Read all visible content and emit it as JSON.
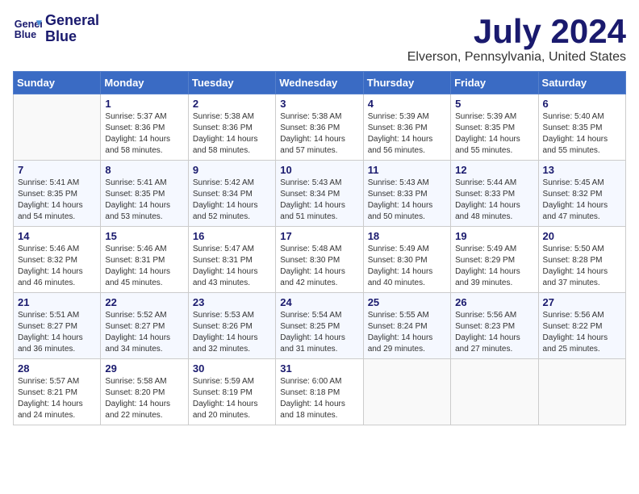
{
  "header": {
    "logo_line1": "General",
    "logo_line2": "Blue",
    "month": "July 2024",
    "location": "Elverson, Pennsylvania, United States"
  },
  "days_of_week": [
    "Sunday",
    "Monday",
    "Tuesday",
    "Wednesday",
    "Thursday",
    "Friday",
    "Saturday"
  ],
  "weeks": [
    [
      {
        "day": "",
        "sunrise": "",
        "sunset": "",
        "daylight": ""
      },
      {
        "day": "1",
        "sunrise": "Sunrise: 5:37 AM",
        "sunset": "Sunset: 8:36 PM",
        "daylight": "Daylight: 14 hours and 58 minutes."
      },
      {
        "day": "2",
        "sunrise": "Sunrise: 5:38 AM",
        "sunset": "Sunset: 8:36 PM",
        "daylight": "Daylight: 14 hours and 58 minutes."
      },
      {
        "day": "3",
        "sunrise": "Sunrise: 5:38 AM",
        "sunset": "Sunset: 8:36 PM",
        "daylight": "Daylight: 14 hours and 57 minutes."
      },
      {
        "day": "4",
        "sunrise": "Sunrise: 5:39 AM",
        "sunset": "Sunset: 8:36 PM",
        "daylight": "Daylight: 14 hours and 56 minutes."
      },
      {
        "day": "5",
        "sunrise": "Sunrise: 5:39 AM",
        "sunset": "Sunset: 8:35 PM",
        "daylight": "Daylight: 14 hours and 55 minutes."
      },
      {
        "day": "6",
        "sunrise": "Sunrise: 5:40 AM",
        "sunset": "Sunset: 8:35 PM",
        "daylight": "Daylight: 14 hours and 55 minutes."
      }
    ],
    [
      {
        "day": "7",
        "sunrise": "Sunrise: 5:41 AM",
        "sunset": "Sunset: 8:35 PM",
        "daylight": "Daylight: 14 hours and 54 minutes."
      },
      {
        "day": "8",
        "sunrise": "Sunrise: 5:41 AM",
        "sunset": "Sunset: 8:35 PM",
        "daylight": "Daylight: 14 hours and 53 minutes."
      },
      {
        "day": "9",
        "sunrise": "Sunrise: 5:42 AM",
        "sunset": "Sunset: 8:34 PM",
        "daylight": "Daylight: 14 hours and 52 minutes."
      },
      {
        "day": "10",
        "sunrise": "Sunrise: 5:43 AM",
        "sunset": "Sunset: 8:34 PM",
        "daylight": "Daylight: 14 hours and 51 minutes."
      },
      {
        "day": "11",
        "sunrise": "Sunrise: 5:43 AM",
        "sunset": "Sunset: 8:33 PM",
        "daylight": "Daylight: 14 hours and 50 minutes."
      },
      {
        "day": "12",
        "sunrise": "Sunrise: 5:44 AM",
        "sunset": "Sunset: 8:33 PM",
        "daylight": "Daylight: 14 hours and 48 minutes."
      },
      {
        "day": "13",
        "sunrise": "Sunrise: 5:45 AM",
        "sunset": "Sunset: 8:32 PM",
        "daylight": "Daylight: 14 hours and 47 minutes."
      }
    ],
    [
      {
        "day": "14",
        "sunrise": "Sunrise: 5:46 AM",
        "sunset": "Sunset: 8:32 PM",
        "daylight": "Daylight: 14 hours and 46 minutes."
      },
      {
        "day": "15",
        "sunrise": "Sunrise: 5:46 AM",
        "sunset": "Sunset: 8:31 PM",
        "daylight": "Daylight: 14 hours and 45 minutes."
      },
      {
        "day": "16",
        "sunrise": "Sunrise: 5:47 AM",
        "sunset": "Sunset: 8:31 PM",
        "daylight": "Daylight: 14 hours and 43 minutes."
      },
      {
        "day": "17",
        "sunrise": "Sunrise: 5:48 AM",
        "sunset": "Sunset: 8:30 PM",
        "daylight": "Daylight: 14 hours and 42 minutes."
      },
      {
        "day": "18",
        "sunrise": "Sunrise: 5:49 AM",
        "sunset": "Sunset: 8:30 PM",
        "daylight": "Daylight: 14 hours and 40 minutes."
      },
      {
        "day": "19",
        "sunrise": "Sunrise: 5:49 AM",
        "sunset": "Sunset: 8:29 PM",
        "daylight": "Daylight: 14 hours and 39 minutes."
      },
      {
        "day": "20",
        "sunrise": "Sunrise: 5:50 AM",
        "sunset": "Sunset: 8:28 PM",
        "daylight": "Daylight: 14 hours and 37 minutes."
      }
    ],
    [
      {
        "day": "21",
        "sunrise": "Sunrise: 5:51 AM",
        "sunset": "Sunset: 8:27 PM",
        "daylight": "Daylight: 14 hours and 36 minutes."
      },
      {
        "day": "22",
        "sunrise": "Sunrise: 5:52 AM",
        "sunset": "Sunset: 8:27 PM",
        "daylight": "Daylight: 14 hours and 34 minutes."
      },
      {
        "day": "23",
        "sunrise": "Sunrise: 5:53 AM",
        "sunset": "Sunset: 8:26 PM",
        "daylight": "Daylight: 14 hours and 32 minutes."
      },
      {
        "day": "24",
        "sunrise": "Sunrise: 5:54 AM",
        "sunset": "Sunset: 8:25 PM",
        "daylight": "Daylight: 14 hours and 31 minutes."
      },
      {
        "day": "25",
        "sunrise": "Sunrise: 5:55 AM",
        "sunset": "Sunset: 8:24 PM",
        "daylight": "Daylight: 14 hours and 29 minutes."
      },
      {
        "day": "26",
        "sunrise": "Sunrise: 5:56 AM",
        "sunset": "Sunset: 8:23 PM",
        "daylight": "Daylight: 14 hours and 27 minutes."
      },
      {
        "day": "27",
        "sunrise": "Sunrise: 5:56 AM",
        "sunset": "Sunset: 8:22 PM",
        "daylight": "Daylight: 14 hours and 25 minutes."
      }
    ],
    [
      {
        "day": "28",
        "sunrise": "Sunrise: 5:57 AM",
        "sunset": "Sunset: 8:21 PM",
        "daylight": "Daylight: 14 hours and 24 minutes."
      },
      {
        "day": "29",
        "sunrise": "Sunrise: 5:58 AM",
        "sunset": "Sunset: 8:20 PM",
        "daylight": "Daylight: 14 hours and 22 minutes."
      },
      {
        "day": "30",
        "sunrise": "Sunrise: 5:59 AM",
        "sunset": "Sunset: 8:19 PM",
        "daylight": "Daylight: 14 hours and 20 minutes."
      },
      {
        "day": "31",
        "sunrise": "Sunrise: 6:00 AM",
        "sunset": "Sunset: 8:18 PM",
        "daylight": "Daylight: 14 hours and 18 minutes."
      },
      {
        "day": "",
        "sunrise": "",
        "sunset": "",
        "daylight": ""
      },
      {
        "day": "",
        "sunrise": "",
        "sunset": "",
        "daylight": ""
      },
      {
        "day": "",
        "sunrise": "",
        "sunset": "",
        "daylight": ""
      }
    ]
  ]
}
